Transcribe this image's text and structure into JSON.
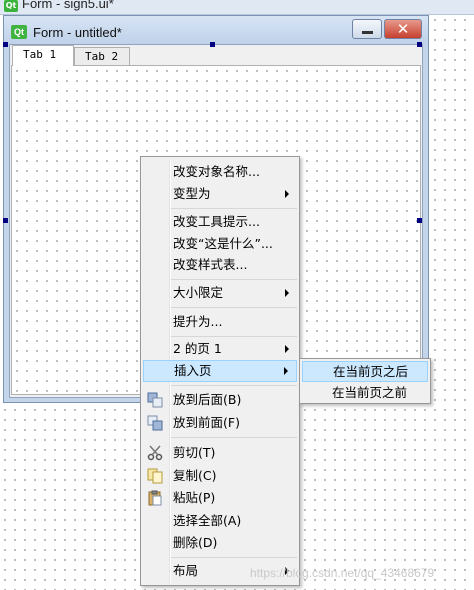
{
  "background_window": {
    "title": "Form - sign5.ui*",
    "app_icon": "Qt"
  },
  "form_window": {
    "app_icon": "Qt",
    "title": "Form - untitled*",
    "minimize_icon": "minimize-icon",
    "close_icon": "close-icon",
    "close_glyph": "✕"
  },
  "tabs": [
    {
      "label": "Tab 1"
    },
    {
      "label": "Tab 2"
    }
  ],
  "context_menu": {
    "items": [
      {
        "label": "改变对象名称..."
      },
      {
        "label": "变型为"
      },
      {
        "label": "改变工具提示..."
      },
      {
        "label": "改变“这是什么”..."
      },
      {
        "label": "改变样式表..."
      },
      {
        "label": "大小限定"
      },
      {
        "label": "提升为..."
      },
      {
        "label": "2 的页 1"
      },
      {
        "label": "插入页"
      },
      {
        "label": "放到后面(B)"
      },
      {
        "label": "放到前面(F)"
      },
      {
        "label": "剪切(T)"
      },
      {
        "label": "复制(C)"
      },
      {
        "label": "粘贴(P)"
      },
      {
        "label": "选择全部(A)"
      },
      {
        "label": "删除(D)"
      },
      {
        "label": "布局"
      }
    ]
  },
  "submenu": {
    "items": [
      {
        "label": "在当前页之后"
      },
      {
        "label": "在当前页之前"
      }
    ]
  },
  "colors": {
    "highlight": "#cce8ff",
    "selection_handle": "#000080",
    "menu_background": "#f0f0f0"
  },
  "watermark": "https://blog.csdn.net/qq_43468679"
}
